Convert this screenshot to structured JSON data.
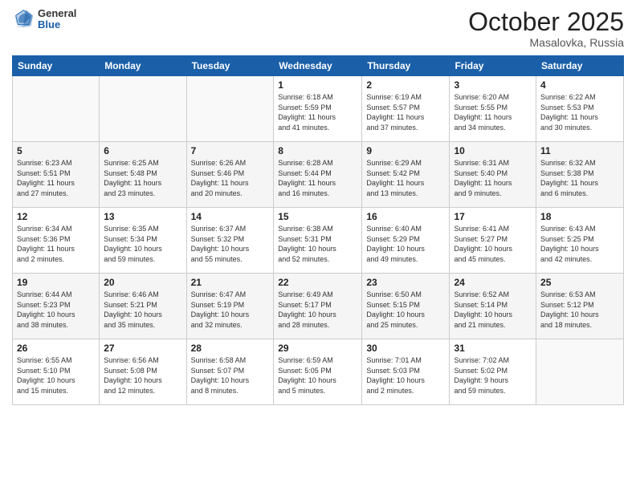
{
  "header": {
    "logo": {
      "general": "General",
      "blue": "Blue"
    },
    "title": "October 2025",
    "subtitle": "Masalovka, Russia"
  },
  "weekdays": [
    "Sunday",
    "Monday",
    "Tuesday",
    "Wednesday",
    "Thursday",
    "Friday",
    "Saturday"
  ],
  "weeks": [
    [
      {
        "num": "",
        "info": ""
      },
      {
        "num": "",
        "info": ""
      },
      {
        "num": "",
        "info": ""
      },
      {
        "num": "1",
        "info": "Sunrise: 6:18 AM\nSunset: 5:59 PM\nDaylight: 11 hours\nand 41 minutes."
      },
      {
        "num": "2",
        "info": "Sunrise: 6:19 AM\nSunset: 5:57 PM\nDaylight: 11 hours\nand 37 minutes."
      },
      {
        "num": "3",
        "info": "Sunrise: 6:20 AM\nSunset: 5:55 PM\nDaylight: 11 hours\nand 34 minutes."
      },
      {
        "num": "4",
        "info": "Sunrise: 6:22 AM\nSunset: 5:53 PM\nDaylight: 11 hours\nand 30 minutes."
      }
    ],
    [
      {
        "num": "5",
        "info": "Sunrise: 6:23 AM\nSunset: 5:51 PM\nDaylight: 11 hours\nand 27 minutes."
      },
      {
        "num": "6",
        "info": "Sunrise: 6:25 AM\nSunset: 5:48 PM\nDaylight: 11 hours\nand 23 minutes."
      },
      {
        "num": "7",
        "info": "Sunrise: 6:26 AM\nSunset: 5:46 PM\nDaylight: 11 hours\nand 20 minutes."
      },
      {
        "num": "8",
        "info": "Sunrise: 6:28 AM\nSunset: 5:44 PM\nDaylight: 11 hours\nand 16 minutes."
      },
      {
        "num": "9",
        "info": "Sunrise: 6:29 AM\nSunset: 5:42 PM\nDaylight: 11 hours\nand 13 minutes."
      },
      {
        "num": "10",
        "info": "Sunrise: 6:31 AM\nSunset: 5:40 PM\nDaylight: 11 hours\nand 9 minutes."
      },
      {
        "num": "11",
        "info": "Sunrise: 6:32 AM\nSunset: 5:38 PM\nDaylight: 11 hours\nand 6 minutes."
      }
    ],
    [
      {
        "num": "12",
        "info": "Sunrise: 6:34 AM\nSunset: 5:36 PM\nDaylight: 11 hours\nand 2 minutes."
      },
      {
        "num": "13",
        "info": "Sunrise: 6:35 AM\nSunset: 5:34 PM\nDaylight: 10 hours\nand 59 minutes."
      },
      {
        "num": "14",
        "info": "Sunrise: 6:37 AM\nSunset: 5:32 PM\nDaylight: 10 hours\nand 55 minutes."
      },
      {
        "num": "15",
        "info": "Sunrise: 6:38 AM\nSunset: 5:31 PM\nDaylight: 10 hours\nand 52 minutes."
      },
      {
        "num": "16",
        "info": "Sunrise: 6:40 AM\nSunset: 5:29 PM\nDaylight: 10 hours\nand 49 minutes."
      },
      {
        "num": "17",
        "info": "Sunrise: 6:41 AM\nSunset: 5:27 PM\nDaylight: 10 hours\nand 45 minutes."
      },
      {
        "num": "18",
        "info": "Sunrise: 6:43 AM\nSunset: 5:25 PM\nDaylight: 10 hours\nand 42 minutes."
      }
    ],
    [
      {
        "num": "19",
        "info": "Sunrise: 6:44 AM\nSunset: 5:23 PM\nDaylight: 10 hours\nand 38 minutes."
      },
      {
        "num": "20",
        "info": "Sunrise: 6:46 AM\nSunset: 5:21 PM\nDaylight: 10 hours\nand 35 minutes."
      },
      {
        "num": "21",
        "info": "Sunrise: 6:47 AM\nSunset: 5:19 PM\nDaylight: 10 hours\nand 32 minutes."
      },
      {
        "num": "22",
        "info": "Sunrise: 6:49 AM\nSunset: 5:17 PM\nDaylight: 10 hours\nand 28 minutes."
      },
      {
        "num": "23",
        "info": "Sunrise: 6:50 AM\nSunset: 5:15 PM\nDaylight: 10 hours\nand 25 minutes."
      },
      {
        "num": "24",
        "info": "Sunrise: 6:52 AM\nSunset: 5:14 PM\nDaylight: 10 hours\nand 21 minutes."
      },
      {
        "num": "25",
        "info": "Sunrise: 6:53 AM\nSunset: 5:12 PM\nDaylight: 10 hours\nand 18 minutes."
      }
    ],
    [
      {
        "num": "26",
        "info": "Sunrise: 6:55 AM\nSunset: 5:10 PM\nDaylight: 10 hours\nand 15 minutes."
      },
      {
        "num": "27",
        "info": "Sunrise: 6:56 AM\nSunset: 5:08 PM\nDaylight: 10 hours\nand 12 minutes."
      },
      {
        "num": "28",
        "info": "Sunrise: 6:58 AM\nSunset: 5:07 PM\nDaylight: 10 hours\nand 8 minutes."
      },
      {
        "num": "29",
        "info": "Sunrise: 6:59 AM\nSunset: 5:05 PM\nDaylight: 10 hours\nand 5 minutes."
      },
      {
        "num": "30",
        "info": "Sunrise: 7:01 AM\nSunset: 5:03 PM\nDaylight: 10 hours\nand 2 minutes."
      },
      {
        "num": "31",
        "info": "Sunrise: 7:02 AM\nSunset: 5:02 PM\nDaylight: 9 hours\nand 59 minutes."
      },
      {
        "num": "",
        "info": ""
      }
    ]
  ]
}
